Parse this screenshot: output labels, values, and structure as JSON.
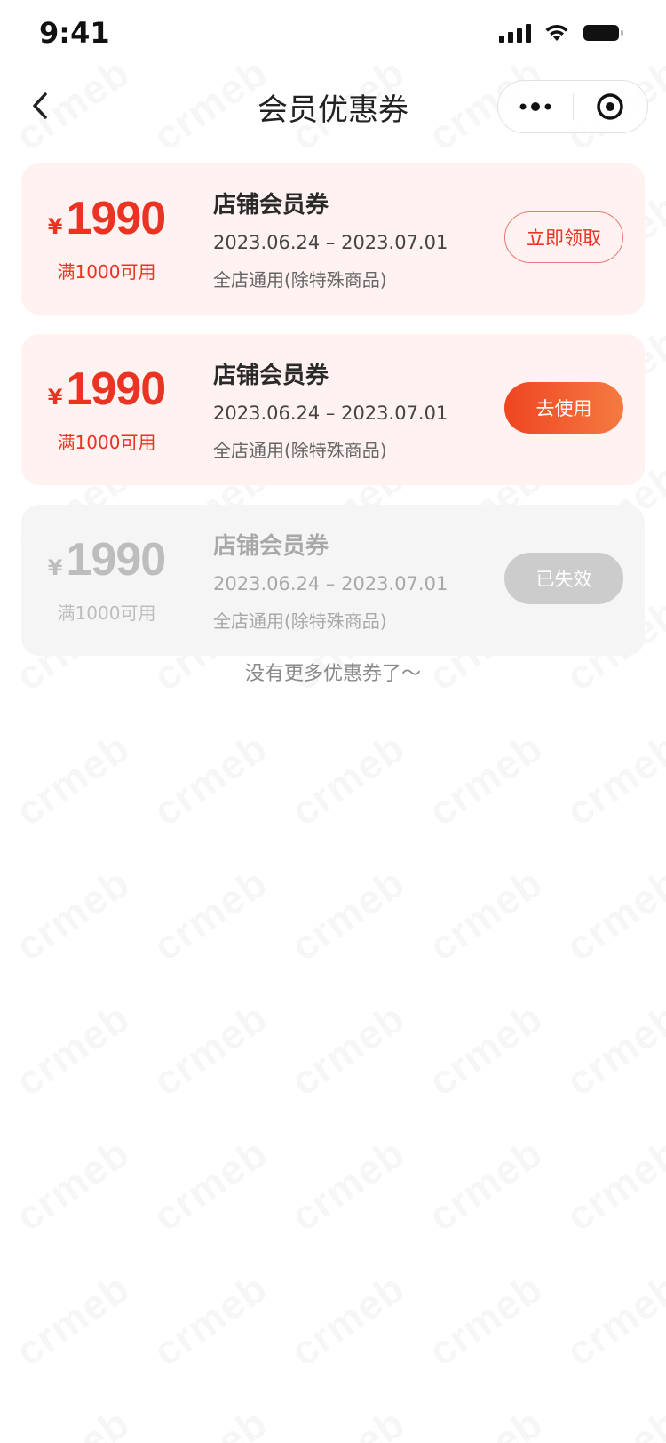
{
  "status_bar": {
    "time": "9:41"
  },
  "nav": {
    "title": "会员优惠券"
  },
  "coupons": [
    {
      "currency": "¥",
      "amount": "1990",
      "threshold": "满1000可用",
      "name": "店铺会员券",
      "date_range": "2023.06.24 – 2023.07.01",
      "scope": "全店通用(除特殊商品)",
      "action_label": "立即领取",
      "state": "claimable"
    },
    {
      "currency": "¥",
      "amount": "1990",
      "threshold": "满1000可用",
      "name": "店铺会员券",
      "date_range": "2023.06.24 – 2023.07.01",
      "scope": "全店通用(除特殊商品)",
      "action_label": "去使用",
      "state": "usable"
    },
    {
      "currency": "¥",
      "amount": "1990",
      "threshold": "满1000可用",
      "name": "店铺会员券",
      "date_range": "2023.06.24 – 2023.07.01",
      "scope": "全店通用(除特殊商品)",
      "action_label": "已失效",
      "state": "expired"
    }
  ],
  "footer": {
    "no_more_text": "没有更多优惠券了～"
  },
  "watermark": {
    "text": "crmeb"
  },
  "colors": {
    "accent": "#e93323",
    "coupon_bg": "#fff2f0",
    "expired_bg": "#f5f5f5",
    "button_gradient_start": "#ee4520",
    "button_gradient_end": "#f57a42",
    "disabled_button": "#cccccc"
  },
  "icons": {
    "back": "chevron-left-icon",
    "more": "more-dots-icon",
    "close_miniprogram": "target-circle-icon",
    "signal": "signal-icon",
    "wifi": "wifi-icon",
    "battery": "battery-icon"
  }
}
